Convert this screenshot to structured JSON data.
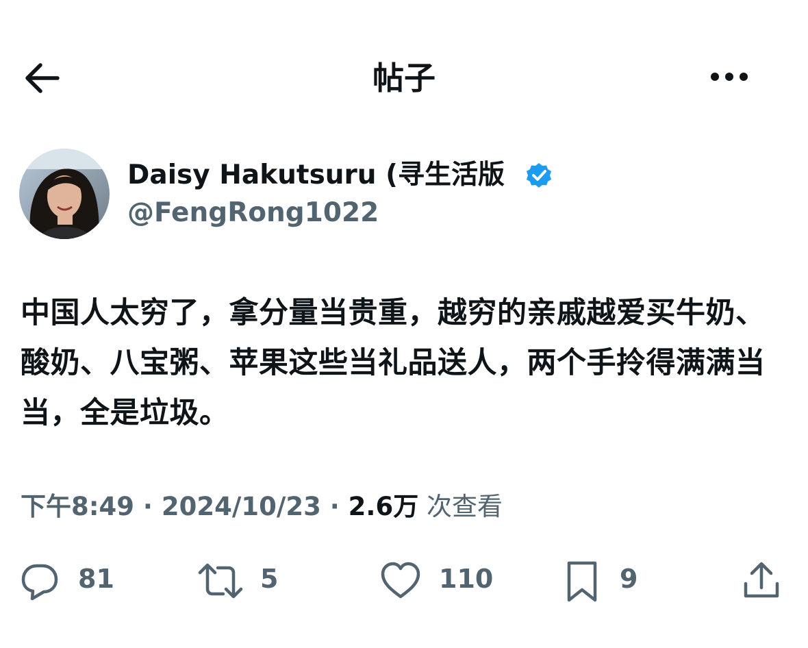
{
  "header": {
    "title": "帖子",
    "back_icon": "arrow-left-icon",
    "more_icon": "more-horizontal-icon"
  },
  "author": {
    "display_name": "Daisy Hakutsuru (寻生活版",
    "handle": "@FengRong1022",
    "verified": true,
    "verified_color": "#1d9bf0"
  },
  "tweet": {
    "text": "中国人太穷了，拿分量当贵重，越穷的亲戚越爱买牛奶、酸奶、八宝粥、苹果这些当礼品送人，两个手拎得满满当当，全是垃圾。",
    "time": "下午8:49",
    "date": "2024/10/23",
    "separator": " · ",
    "views_count": "2.6万",
    "views_label": " 次查看"
  },
  "actions": {
    "replies": "81",
    "retweets": "5",
    "likes": "110",
    "bookmarks": "9"
  },
  "colors": {
    "text": "#0f1419",
    "secondary": "#536471",
    "accent": "#1d9bf0",
    "background": "#ffffff"
  }
}
